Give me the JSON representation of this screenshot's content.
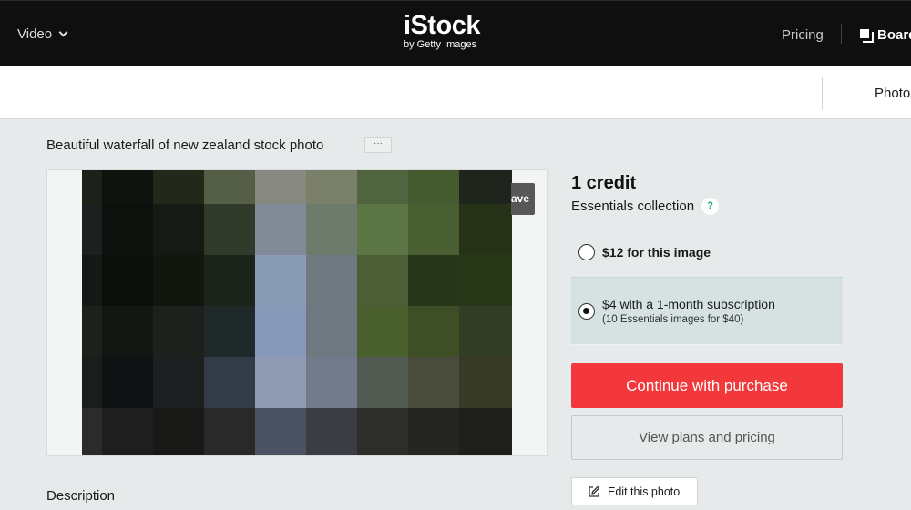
{
  "header": {
    "nav_video": "Video",
    "logo_main": "iStock",
    "logo_sub": "by Getty Images",
    "nav_pricing": "Pricing",
    "nav_boards": "Boards"
  },
  "subnav": {
    "photos_label": "Photos"
  },
  "asset": {
    "title": "Beautiful waterfall of new zealand stock photo",
    "more_label": "···",
    "save_label": "Save",
    "description_heading": "Description",
    "pixel_colors": [
      [
        "#1d2119",
        "#10120e",
        "#23281b",
        "#555f47",
        "#878980",
        "#7a8069",
        "#516440",
        "#465a30",
        "#1f241c"
      ],
      [
        "#1e2020",
        "#0e100d",
        "#171a14",
        "#313a2a",
        "#818b97",
        "#6c7b6c",
        "#5b7644",
        "#4a5f31",
        "#253217"
      ],
      [
        "#161815",
        "#0c0e0a",
        "#12160f",
        "#1b231b",
        "#8a9cb5",
        "#6e7a80",
        "#4c5e36",
        "#273519",
        "#273718"
      ],
      [
        "#1e201b",
        "#121714",
        "#1d211e",
        "#1f292a",
        "#8799b9",
        "#6d7880",
        "#4a5f2e",
        "#3e4e25",
        "#333c24"
      ],
      [
        "#1b1d1d",
        "#0f1313",
        "#1c2020",
        "#333b48",
        "#8f9cb3",
        "#727a8b",
        "#535a52",
        "#494c3d",
        "#363a27"
      ],
      [
        "#2b2b2b",
        "#1e1e1e",
        "#181816",
        "#292929",
        "#4a5263",
        "#3a3d43",
        "#2d2e29",
        "#252622",
        "#1e1f1b"
      ]
    ]
  },
  "purchase": {
    "credit_label": "1 credit",
    "collection_label": "Essentials collection",
    "help_icon_label": "?",
    "options": [
      {
        "main": "$12 for this image",
        "sub": "",
        "selected": false
      },
      {
        "main": "$4 with a 1-month subscription",
        "sub": "(10 Essentials images for $40)",
        "selected": true
      }
    ],
    "continue_label": "Continue with purchase",
    "plans_label": "View plans and pricing",
    "edit_label": "Edit this photo"
  },
  "colors": {
    "primary_red": "#f2383b",
    "header_bg": "#0f0f0f",
    "page_bg": "#e6eaea",
    "selected_option_bg": "#d5e2e1",
    "help_icon_teal": "#17a87b"
  }
}
